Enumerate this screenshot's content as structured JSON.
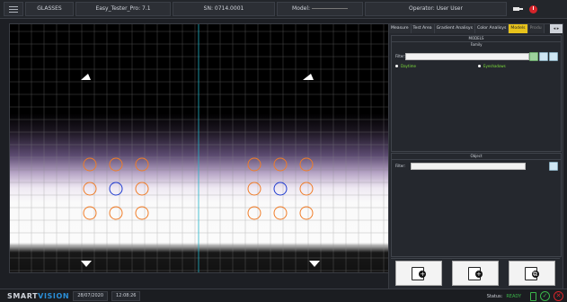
{
  "topbar": {
    "product": "GLASSES",
    "tester": "Easy_Tester_Pro: 7.1",
    "serial": "SN: 0714.0001",
    "model_label": "Model:",
    "model_value": "",
    "operator": "Operator: User User"
  },
  "tabs": [
    {
      "label": "Measure",
      "active": false
    },
    {
      "label": "Test Area",
      "active": false
    },
    {
      "label": "Gradient Analisys",
      "active": false
    },
    {
      "label": "Color Analisys",
      "active": false
    },
    {
      "label": "Models",
      "active": true
    },
    {
      "label": "Produ",
      "active": false
    }
  ],
  "tabs_scroll_label": "◂ ▸",
  "models": {
    "title": "MODELS",
    "family_title": "Family",
    "filter_label": "Filter:",
    "filter_value": "",
    "radio_options": [
      "Daytime",
      "Eyeshadows"
    ],
    "object_title": "Object",
    "object_filter_label": "Filter:",
    "object_filter_value": ""
  },
  "actions": [
    "add-model",
    "add-object",
    "copy-object"
  ],
  "statusbar": {
    "brand_a": "SMART",
    "brand_b": "VISION",
    "date": "28/07/2020",
    "time": "12:08:26",
    "status_label": "Status:",
    "status_value": "READY"
  },
  "colors": {
    "accent": "#e8c31b",
    "brand": "#2a8fd8",
    "ok": "#3bb54a",
    "error": "#d5242a",
    "roi_outer": "#f07c27",
    "roi_center": "#1f3bd0"
  }
}
